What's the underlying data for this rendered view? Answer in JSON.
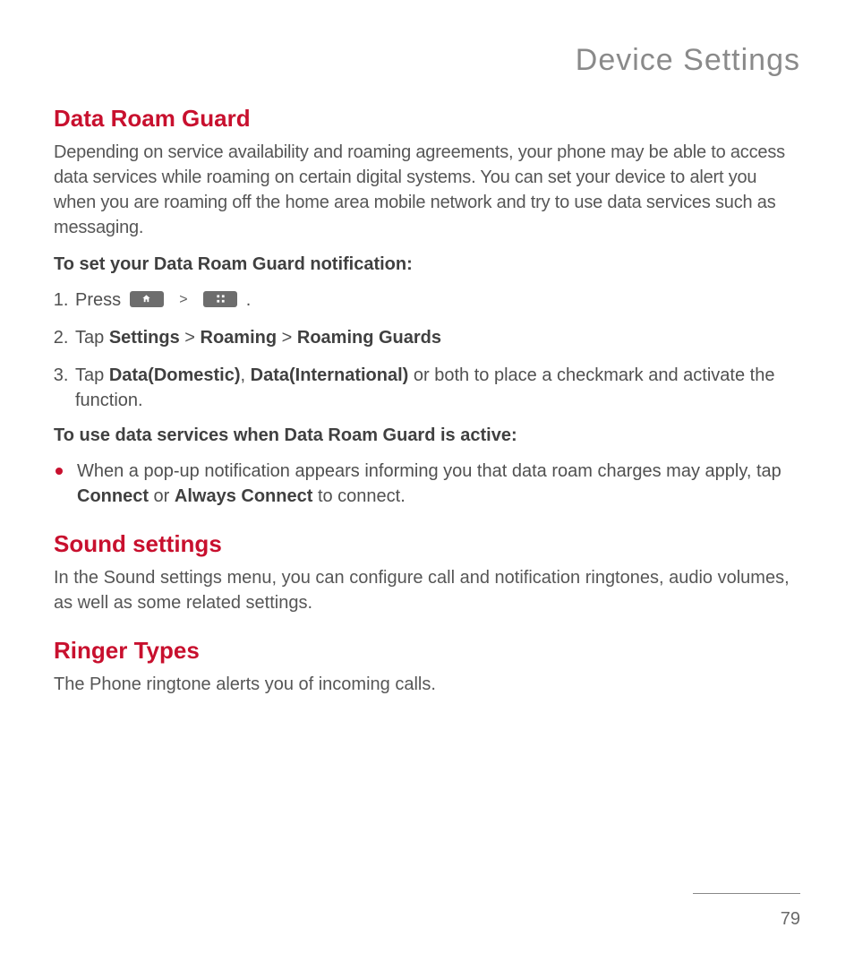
{
  "header": {
    "title": "Device Settings"
  },
  "sections": {
    "dataRoamGuard": {
      "heading": "Data Roam Guard",
      "intro": "Depending on service availability and roaming agreements, your phone may be able to access data services while roaming on certain digital systems. You can set your device to alert you when you are roaming off the home area mobile network and try to use data services such as messaging.",
      "sub1": "To set your Data Roam Guard notification:",
      "steps": {
        "s1_pre": "Press",
        "s1_post": ".",
        "s2_pre": "Tap ",
        "s2_b1": "Settings",
        "s2_sep": " > ",
        "s2_b2": "Roaming",
        "s2_b3": "Roaming Guards",
        "s3_pre": "Tap ",
        "s3_b1": "Data(Domestic)",
        "s3_mid": ", ",
        "s3_b2": "Data(International)",
        "s3_post": " or both  to place a checkmark and activate the function."
      },
      "sub2": "To use data services when Data Roam Guard is active:",
      "bullet": {
        "pre": "When a pop-up notification appears informing you that data roam charges may apply, tap ",
        "b1": "Connect",
        "mid": " or ",
        "b2": "Always Connect",
        "post": " to connect."
      }
    },
    "soundSettings": {
      "heading": "Sound settings",
      "body": "In the Sound settings menu, you can configure call and notification ringtones, audio volumes, as well as some related settings."
    },
    "ringerTypes": {
      "heading": "Ringer Types",
      "body": "The Phone ringtone alerts you of incoming calls."
    }
  },
  "pageNumber": "79",
  "icons": {
    "home": "home-icon",
    "apps": "apps-icon"
  }
}
